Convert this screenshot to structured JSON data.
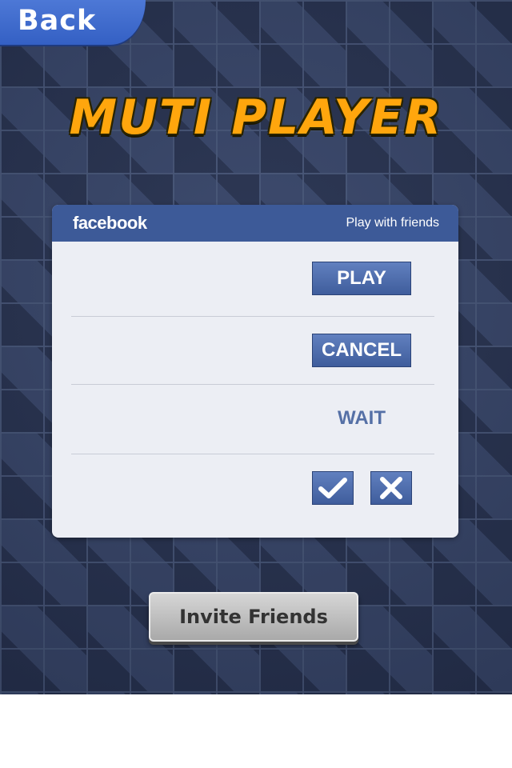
{
  "header": {
    "back_label": "Back",
    "title": "MUTI PLAYER"
  },
  "panel": {
    "brand": "facebook",
    "subtitle": "Play with friends",
    "play_label": "PLAY",
    "cancel_label": "CANCEL",
    "wait_label": "WAIT",
    "accept_icon": "checkmark-icon",
    "decline_icon": "close-icon"
  },
  "footer": {
    "invite_label": "Invite Friends"
  },
  "colors": {
    "facebook_blue": "#3d5a98",
    "title_orange": "#ffa60d",
    "back_blue": "#3f6acb",
    "panel_bg": "#eceef4"
  }
}
